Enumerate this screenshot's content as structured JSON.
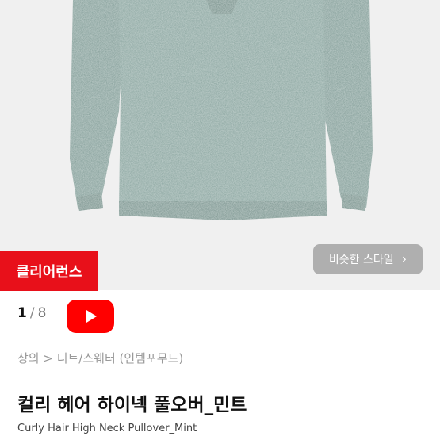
{
  "product_image": {
    "alt_subject": "sweater-photo",
    "color": "#7f9c96"
  },
  "badge": {
    "label": "클리어런스",
    "color": "#e8101a"
  },
  "similar_style_button": {
    "label": "비슷한 스타일",
    "icon": "chevron-right-icon"
  },
  "pager": {
    "current": "1",
    "separator": "/",
    "total": "8"
  },
  "video_button": {
    "icon": "youtube-play-icon",
    "color": "#ff0000"
  },
  "breadcrumb": {
    "text": "상의 > 니트/스웨터 (인템포무드)"
  },
  "product": {
    "title_ko": "컬리 헤어 하이넥 풀오버_민트",
    "title_en": "Curly Hair High Neck Pullover_Mint"
  }
}
